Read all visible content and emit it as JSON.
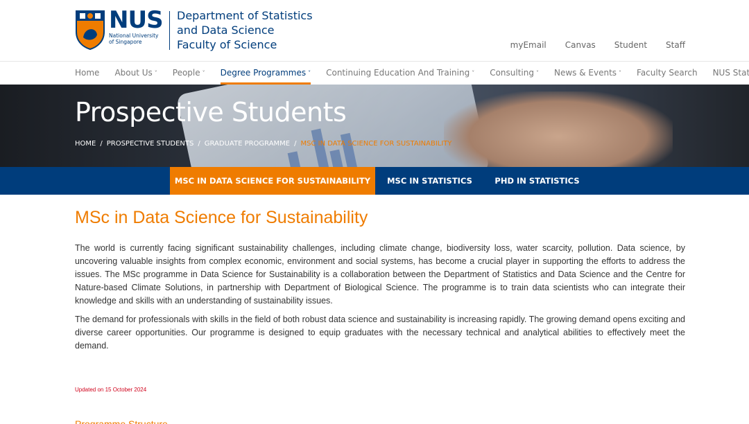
{
  "header": {
    "logo_word": "NUS",
    "logo_sub_line1": "National University",
    "logo_sub_line2": "of Singapore",
    "dept_line1": "Department of Statistics",
    "dept_line2": "and Data Science",
    "dept_line3": "Faculty of Science",
    "util_links": [
      "myEmail",
      "Canvas",
      "Student",
      "Staff"
    ]
  },
  "nav": {
    "items": [
      {
        "label": "Home",
        "dropdown": false
      },
      {
        "label": "About Us",
        "dropdown": true
      },
      {
        "label": "People",
        "dropdown": true
      },
      {
        "label": "Degree Programmes",
        "dropdown": true
      },
      {
        "label": "Continuing Education And Training",
        "dropdown": true
      },
      {
        "label": "Consulting",
        "dropdown": true
      },
      {
        "label": "News & Events",
        "dropdown": true
      },
      {
        "label": "Faculty Search",
        "dropdown": false
      },
      {
        "label": "NUS Statistics Soci",
        "dropdown": false
      }
    ],
    "active_label": "Degree Programmes"
  },
  "banner": {
    "title": "Prospective Students",
    "breadcrumb": [
      "HOME",
      "PROSPECTIVE STUDENTS",
      "GRADUATE PROGRAMME",
      "MSC IN DATA SCIENCE FOR SUSTAINABILITY"
    ],
    "separator": "/"
  },
  "subtabs": [
    {
      "label": "MSC IN DATA SCIENCE FOR SUSTAINABILITY",
      "active": true
    },
    {
      "label": "MSC IN STATISTICS",
      "active": false
    },
    {
      "label": "PHD IN STATISTICS",
      "active": false
    }
  ],
  "main": {
    "heading": "MSc in Data Science for Sustainability",
    "paragraph1": "The world is currently facing significant sustainability challenges, including climate change, biodiversity loss, water scarcity, pollution.  Data science, by uncovering valuable insights from complex economic, environment and social systems, has become a crucial player in supporting the efforts to address the issues.  The MSc programme in Data Science for Sustainability is a collaboration between the Department of Statistics and Data Science and the Centre for Nature-based Climate Solutions, in partnership with Department of Biological Science. The programme is to train data scientists who can integrate their knowledge and skills with an understanding of sustainability issues.",
    "paragraph2": "The demand for professionals with skills in the field of both robust data science and sustainability is increasing rapidly.  The growing demand opens exciting and diverse career opportunities.  Our programme is designed to equip graduates with the necessary technical and analytical abilities to effectively meet the demand.",
    "updated": "Updated on 15 October 2024",
    "next_heading": "Programme Structure"
  },
  "colors": {
    "brand_blue": "#003d7c",
    "accent_orange": "#ef7c00"
  }
}
